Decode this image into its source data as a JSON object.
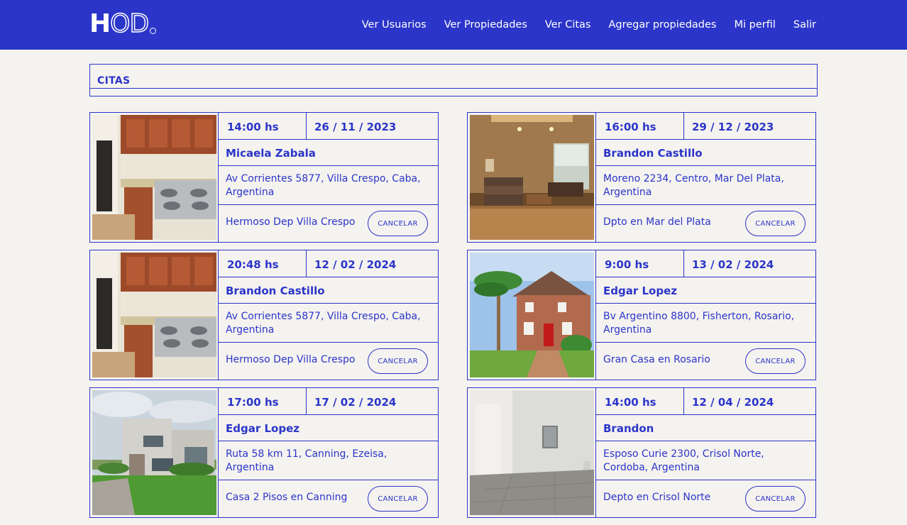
{
  "brand": {
    "logo_solid": "H",
    "logo_outline": "OD"
  },
  "nav": {
    "items": [
      {
        "label": "Ver Usuarios"
      },
      {
        "label": "Ver Propiedades"
      },
      {
        "label": "Ver Citas"
      },
      {
        "label": "Agregar propiedades"
      },
      {
        "label": "Mi perfil"
      },
      {
        "label": "Salir"
      }
    ]
  },
  "section": {
    "title": "CITAS"
  },
  "appointments": [
    {
      "time": "14:00 hs",
      "date": "26 / 11 / 2023",
      "name": "Micaela Zabala",
      "address": "Av Corrientes 5877, Villa Crespo, Caba, Argentina",
      "property": "Hermoso Dep Villa Crespo",
      "cancel_label": "CANCELAR",
      "image": "kitchen-photo"
    },
    {
      "time": "16:00 hs",
      "date": "29 / 12 / 2023",
      "name": "Brandon Castillo",
      "address": "Moreno 2234, Centro, Mar Del Plata, Argentina",
      "property": "Dpto en Mar del Plata",
      "cancel_label": "CANCELAR",
      "image": "living-room-photo"
    },
    {
      "time": "20:48 hs",
      "date": "12 / 02 / 2024",
      "name": "Brandon Castillo",
      "address": "Av Corrientes 5877, Villa Crespo, Caba, Argentina",
      "property": "Hermoso Dep Villa Crespo",
      "cancel_label": "CANCELAR",
      "image": "kitchen-photo"
    },
    {
      "time": "9:00 hs",
      "date": "13 / 02 / 2024",
      "name": "Edgar Lopez",
      "address": "Bv Argentino 8800, Fisherton, Rosario, Argentina",
      "property": "Gran Casa en Rosario",
      "cancel_label": "CANCELAR",
      "image": "house-palm-photo"
    },
    {
      "time": "17:00 hs",
      "date": "17 / 02 / 2024",
      "name": "Edgar Lopez",
      "address": "Ruta 58 km 11, Canning, Ezeisa, Argentina",
      "property": "Casa 2 Pisos en Canning",
      "cancel_label": "CANCELAR",
      "image": "modern-house-photo"
    },
    {
      "time": "14:00 hs",
      "date": "12 / 04 / 2024",
      "name": "Brandon",
      "address": "Esposo Curie 2300, Crisol Norte, Cordoba, Argentina",
      "property": "Depto en Crisol Norte",
      "cancel_label": "CANCELAR",
      "image": "empty-room-photo"
    }
  ],
  "colors": {
    "primary": "#2b35c9",
    "background": "#f5f3ef",
    "nav_text": "#ffffff"
  }
}
